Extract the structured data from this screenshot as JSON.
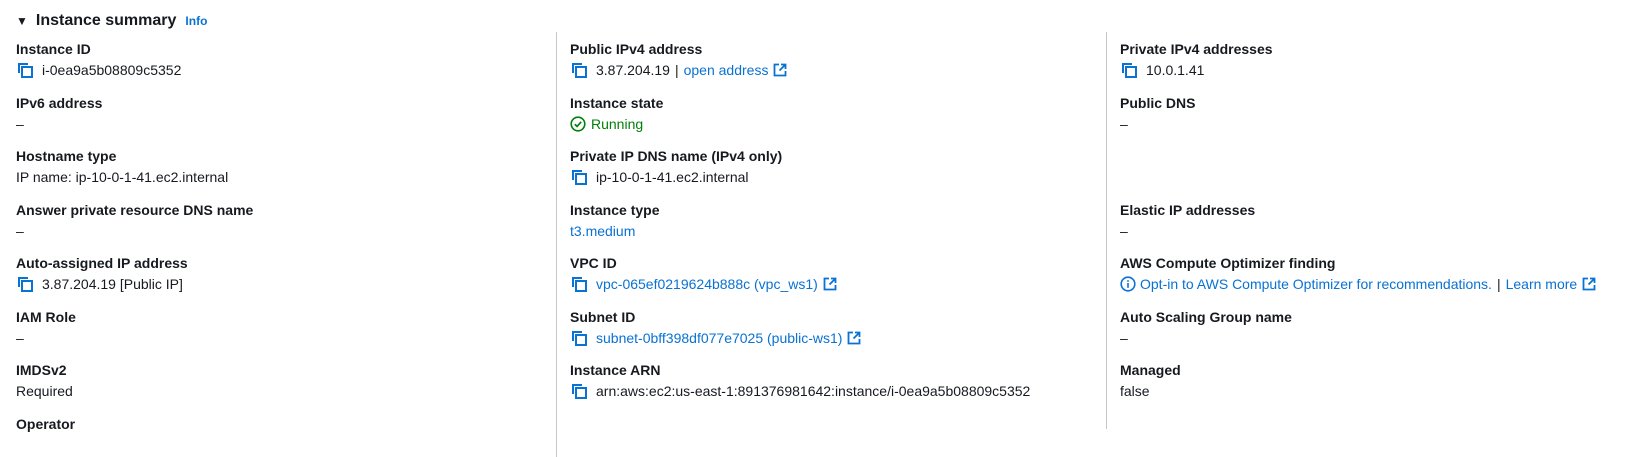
{
  "header": {
    "title": "Instance summary",
    "info": "Info"
  },
  "col1": {
    "instance_id": {
      "label": "Instance ID",
      "value": "i-0ea9a5b08809c5352"
    },
    "ipv6": {
      "label": "IPv6 address",
      "value": "–"
    },
    "hostname_type": {
      "label": "Hostname type",
      "value": "IP name: ip-10-0-1-41.ec2.internal"
    },
    "answer_dns": {
      "label": "Answer private resource DNS name",
      "value": "–"
    },
    "auto_ip": {
      "label": "Auto-assigned IP address",
      "value": "3.87.204.19 [Public IP]"
    },
    "iam_role": {
      "label": "IAM Role",
      "value": "–"
    },
    "imdsv2": {
      "label": "IMDSv2",
      "value": "Required"
    },
    "operator": {
      "label": "Operator"
    }
  },
  "col2": {
    "public_ipv4": {
      "label": "Public IPv4 address",
      "value": "3.87.204.19",
      "separator": "|",
      "link": "open address"
    },
    "instance_state": {
      "label": "Instance state",
      "value": "Running"
    },
    "private_dns": {
      "label": "Private IP DNS name (IPv4 only)",
      "value": "ip-10-0-1-41.ec2.internal"
    },
    "instance_type": {
      "label": "Instance type",
      "value": "t3.medium"
    },
    "vpc_id": {
      "label": "VPC ID",
      "value": "vpc-065ef0219624b888c (vpc_ws1)"
    },
    "subnet_id": {
      "label": "Subnet ID",
      "value": "subnet-0bff398df077e7025 (public-ws1)"
    },
    "instance_arn": {
      "label": "Instance ARN",
      "value": "arn:aws:ec2:us-east-1:891376981642:instance/i-0ea9a5b08809c5352"
    }
  },
  "col3": {
    "private_ipv4": {
      "label": "Private IPv4 addresses",
      "value": "10.0.1.41"
    },
    "public_dns": {
      "label": "Public DNS",
      "value": "–"
    },
    "elastic_ip": {
      "label": "Elastic IP addresses",
      "value": "–"
    },
    "optimizer": {
      "label": "AWS Compute Optimizer finding",
      "link": "Opt-in to AWS Compute Optimizer for recommendations.",
      "separator": "|",
      "learn_more": "Learn more"
    },
    "asg_name": {
      "label": "Auto Scaling Group name",
      "value": "–"
    },
    "managed": {
      "label": "Managed",
      "value": "false"
    }
  },
  "colors": {
    "link": "#0972d3",
    "success": "#037f0c",
    "text": "#16191f",
    "divider": "#c6c6cd"
  },
  "icons": {
    "copy": "copy-icon",
    "external": "external-link-icon",
    "status": "check-circle-icon",
    "info": "info-circle-icon",
    "caret": "caret-down-icon"
  }
}
